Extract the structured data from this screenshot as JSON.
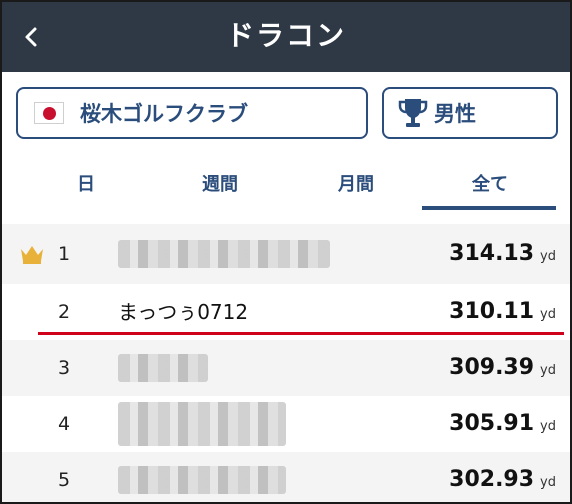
{
  "header": {
    "title": "ドラコン",
    "back_icon": "chevron-left-icon"
  },
  "filters": {
    "club_label": "桜木ゴルフクラブ",
    "club_flag": "japan-flag-icon",
    "gender_label": "男性",
    "gender_icon": "trophy-icon"
  },
  "tabs": [
    {
      "label": "日",
      "active": false
    },
    {
      "label": "週間",
      "active": false
    },
    {
      "label": "月間",
      "active": false
    },
    {
      "label": "全て",
      "active": true
    }
  ],
  "leaderboard": [
    {
      "rank": "1",
      "name": "",
      "score": "314.13",
      "unit": "yd",
      "crown": true
    },
    {
      "rank": "2",
      "name": "まっつぅ0712",
      "score": "310.11",
      "unit": "yd",
      "crown": false
    },
    {
      "rank": "3",
      "name": "",
      "score": "309.39",
      "unit": "yd",
      "crown": false
    },
    {
      "rank": "4",
      "name": "",
      "score": "305.91",
      "unit": "yd",
      "crown": false
    },
    {
      "rank": "5",
      "name": "",
      "score": "302.93",
      "unit": "yd",
      "crown": false
    }
  ],
  "colors": {
    "header_bg": "#2f3946",
    "accent": "#2b4d7c",
    "crown": "#e8b23a",
    "highlight_line": "#d0021b"
  }
}
